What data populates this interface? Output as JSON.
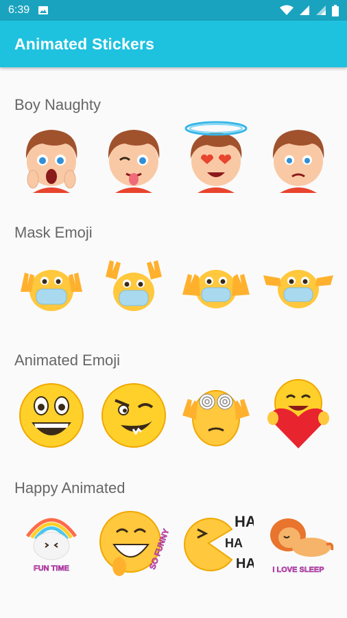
{
  "status_bar": {
    "time": "6:39",
    "icons": [
      "image-icon",
      "wifi-icon",
      "signal-icon",
      "signal-icon",
      "battery-icon"
    ]
  },
  "app_bar": {
    "title": "Animated Stickers"
  },
  "sections": [
    {
      "title": "Boy Naughty",
      "stickers": [
        "crying-boy",
        "tongue-out-boy",
        "halo-heart-eyes-boy",
        "sad-boy"
      ]
    },
    {
      "title": "Mask Emoji",
      "stickers": [
        "mask-victory-emoji",
        "mask-victory-emoji",
        "mask-hands-emoji",
        "mask-pointing-emoji"
      ]
    },
    {
      "title": "Animated Emoji",
      "stickers": [
        "laughing-emoji",
        "winking-silly-emoji",
        "dizzy-eyes-emoji",
        "heart-hug-emoji"
      ]
    },
    {
      "title": "Happy Animated",
      "stickers": [
        "fun-time-cloud",
        "so-funny-emoji",
        "haha-pacman",
        "i-love-sleep-lion"
      ],
      "sticker_texts": [
        "FUN TIME",
        "SO FUNNY",
        "HA",
        "HA",
        "HA",
        "I LOVE SLEEP"
      ]
    }
  ],
  "colors": {
    "status_bar": "#1aa3bf",
    "app_bar": "#1ec2df",
    "background": "#fafafa",
    "section_title": "#666666"
  }
}
